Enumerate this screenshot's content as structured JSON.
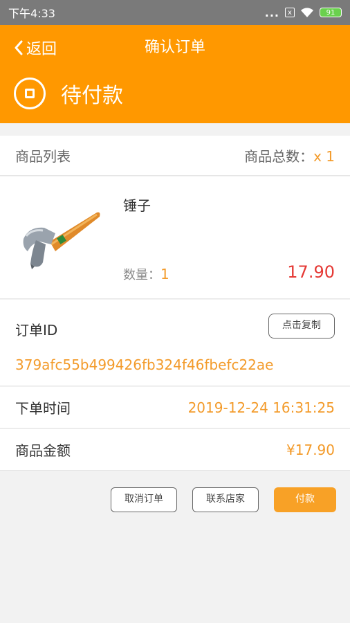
{
  "status_bar": {
    "time": "下午4:33",
    "dots": "...",
    "sim_label": "x",
    "battery": "91"
  },
  "header": {
    "back_label": "返回",
    "title": "确认订单",
    "order_status": "待付款"
  },
  "product_list": {
    "title": "商品列表",
    "total_label": "商品总数：",
    "total_value": "x 1"
  },
  "product": {
    "name": "锤子",
    "qty_label": "数量：",
    "qty_value": "1",
    "price": "17.90"
  },
  "order": {
    "id_label": "订单ID",
    "copy_label": "点击复制",
    "id_value": "379afc55b499426fb324f46fbefc22ae",
    "time_label": "下单时间",
    "time_value": "2019-12-24 16:31:25",
    "amount_label": "商品金额",
    "amount_value": "¥17.90"
  },
  "actions": {
    "cancel": "取消订单",
    "contact": "联系店家",
    "pay": "付款"
  },
  "colors": {
    "brand": "#ff9800",
    "accent": "#f39b2b",
    "price": "#e53935"
  },
  "icons": [
    "back-chevron-icon",
    "stop-circle-icon",
    "wifi-icon",
    "battery-icon",
    "sim-icon",
    "hammer-image"
  ]
}
